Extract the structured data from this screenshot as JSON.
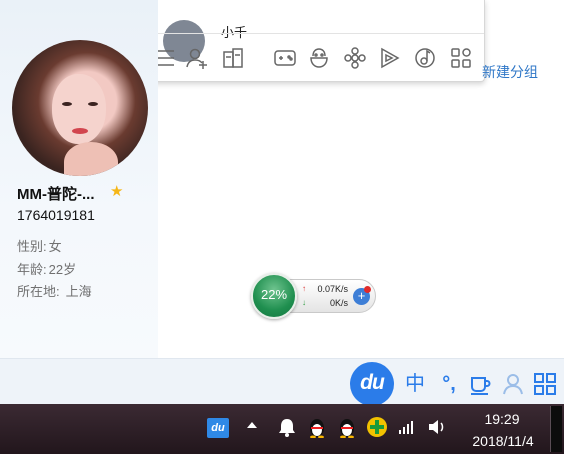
{
  "popup": {
    "partial_name": "小千",
    "icons": [
      "menu-icon",
      "add-contact-icon",
      "app-manager-icon",
      "game-icon",
      "qq-pet-icon",
      "flower-icon",
      "video-play-icon",
      "music-icon",
      "more-apps-icon"
    ]
  },
  "groups": {
    "new_group_label": "新建分组"
  },
  "profile": {
    "nickname": "MM-普陀-...",
    "qq_number": "1764019181",
    "gender_label": "性别:",
    "gender_value": "女",
    "age_label": "年龄:",
    "age_value": "22岁",
    "location_label": "所在地:",
    "location_value": "上海"
  },
  "speed_widget": {
    "percent": "22%",
    "upload": "0.07K/s",
    "download": "0K/s",
    "up_arrow": "↑",
    "down_arrow": "↓",
    "plus": "+"
  },
  "ime_bar": {
    "logo": "du",
    "mode": "中",
    "punct": "°,",
    "icons": [
      "cup-icon",
      "user-icon",
      "grid-icon"
    ]
  },
  "taskbar": {
    "tray_icons": [
      "baidu-ime-icon",
      "show-hidden-icon",
      "notification-bell-icon",
      "qq-penguin-icon",
      "qq-penguin-icon",
      "360-security-icon",
      "network-signal-icon",
      "volume-icon"
    ],
    "du_label": "du",
    "time": "19:29",
    "date": "2018/11/4"
  },
  "colors": {
    "accent": "#2b7ce9",
    "link": "#2f77c7",
    "star": "#f5b617",
    "speed_green": "#1f8f4f",
    "taskbar": "#2a1c23"
  }
}
